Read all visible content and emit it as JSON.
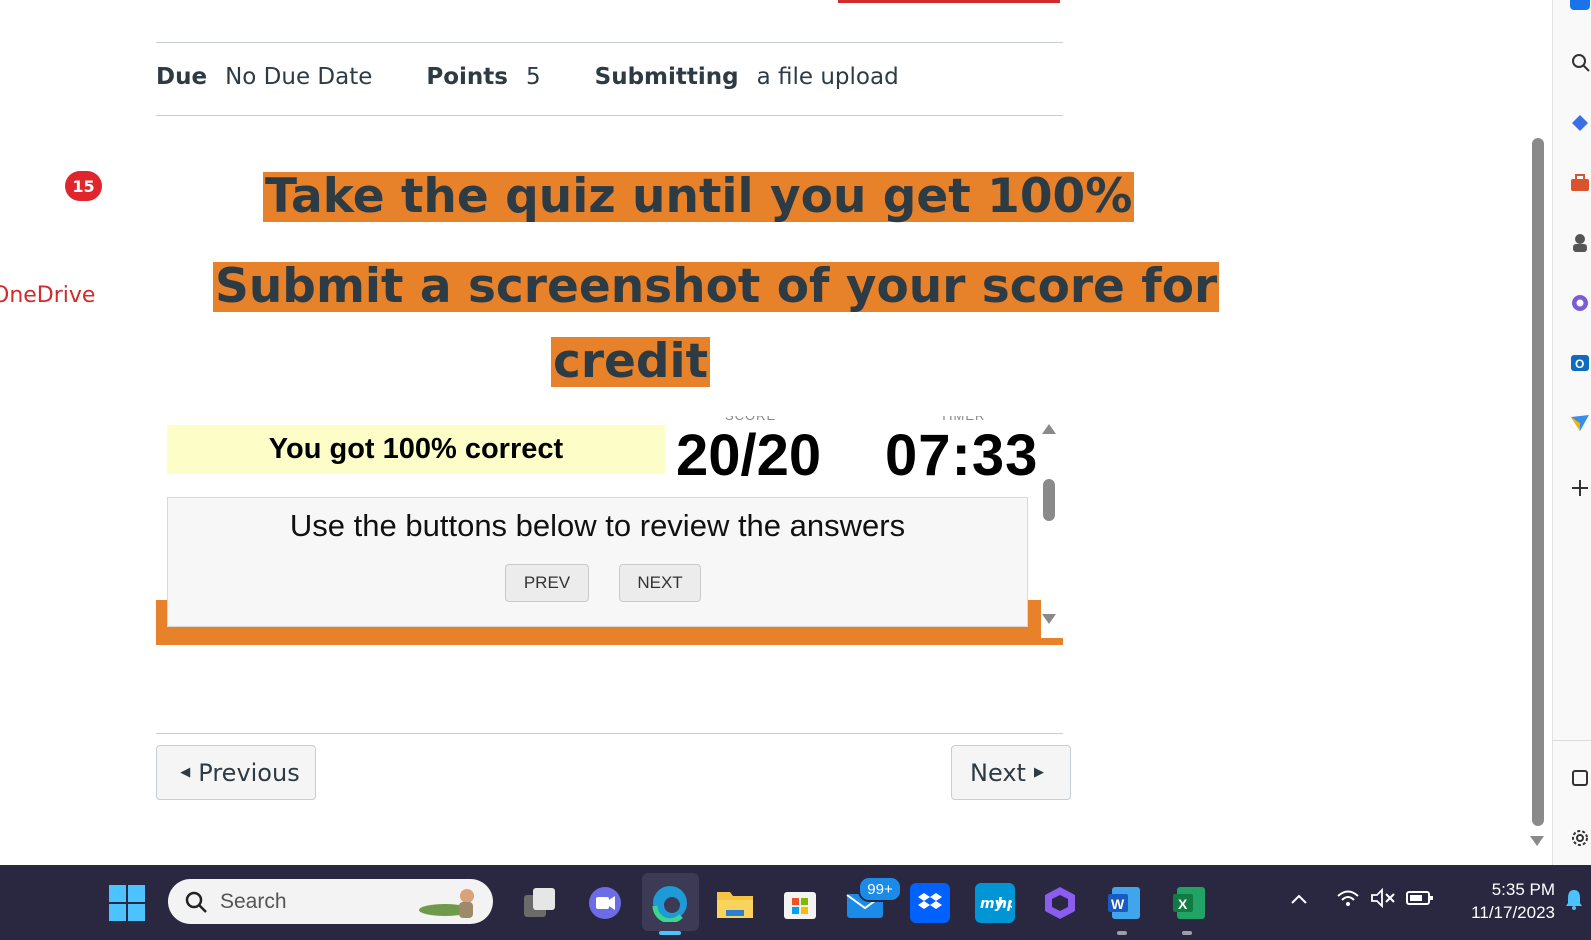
{
  "meta": {
    "due_label": "Due",
    "due_value": "No Due Date",
    "points_label": "Points",
    "points_value": "5",
    "submitting_label": "Submitting",
    "submitting_value": "a file upload"
  },
  "nav": {
    "badge_count": "15",
    "onedrive_label": "OneDrive"
  },
  "content": {
    "heading1": "Take the quiz until you get 100%",
    "heading2_line1": "Submit a screenshot of your score for",
    "heading2_line2": "credit"
  },
  "quiz": {
    "result_text": "You got 100% correct",
    "score_label": "SCORE",
    "score_value": "20/20",
    "timer_label": "TIMER",
    "timer_value": "07:33",
    "review_text": "Use the buttons below to review the answers",
    "prev_label": "PREV",
    "next_label": "NEXT"
  },
  "pager": {
    "previous_label": "Previous",
    "next_label": "Next"
  },
  "taskbar": {
    "search_placeholder": "Search",
    "mail_badge": "99+",
    "time": "5:35 PM",
    "date": "11/17/2023"
  },
  "colors": {
    "highlight": "#e7822a",
    "link_red": "#d12b2b",
    "taskbar_bg": "#2a2740"
  }
}
